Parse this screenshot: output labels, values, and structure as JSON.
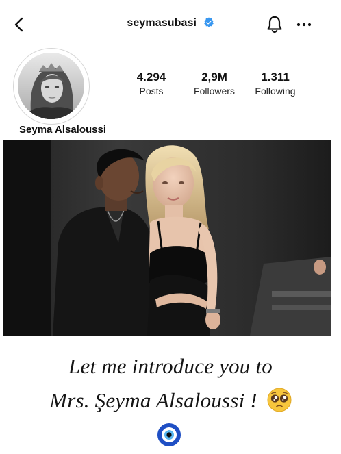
{
  "header": {
    "username": "seymasubasi",
    "verified": true,
    "icons": [
      "back-chevron-icon",
      "verified-badge-icon",
      "bell-icon",
      "more-dots-icon"
    ]
  },
  "profile": {
    "display_name": "Seyma Alsaloussi",
    "stats": {
      "posts_value": "4.294",
      "posts_label": "Posts",
      "followers_value": "2,9M",
      "followers_label": "Followers",
      "following_value": "1.311",
      "following_label": "Following"
    }
  },
  "caption": {
    "line1": "Let me introduce you to",
    "line2": "Mrs. Şeyma Alsaloussi !",
    "emojis": [
      "pleading-face",
      "nazar-evil-eye"
    ]
  },
  "colors": {
    "verified_blue": "#3897f0",
    "nazar_blue": "#1f4fc4",
    "text": "#111111"
  }
}
